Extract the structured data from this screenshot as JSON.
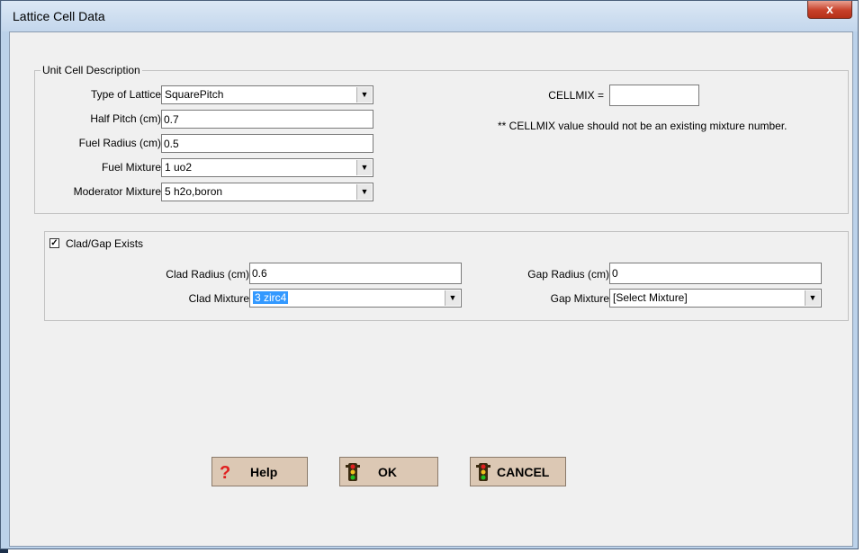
{
  "window": {
    "title": "Lattice Cell Data",
    "close_label": "x"
  },
  "unit_cell": {
    "legend": "Unit Cell Description",
    "type_of_lattice": {
      "label": "Type of Lattice",
      "value": "SquarePitch"
    },
    "half_pitch": {
      "label": "Half Pitch (cm)",
      "value": "0.7"
    },
    "fuel_radius": {
      "label": "Fuel Radius (cm)",
      "value": "0.5"
    },
    "fuel_mixture": {
      "label": "Fuel Mixture",
      "value": "1 uo2"
    },
    "moderator_mixture": {
      "label": "Moderator Mixture",
      "value": "5 h2o,boron"
    },
    "cellmix": {
      "label": "CELLMIX =",
      "value": ""
    },
    "cellmix_note": "** CELLMIX value should not be an existing mixture number."
  },
  "clad_gap": {
    "checkbox_label": "Clad/Gap Exists",
    "checked": true,
    "clad_radius": {
      "label": "Clad Radius (cm)",
      "value": "0.6"
    },
    "clad_mixture": {
      "label": "Clad Mixture",
      "value": "3 zirc4"
    },
    "gap_radius": {
      "label": "Gap Radius (cm)",
      "value": "0"
    },
    "gap_mixture": {
      "label": "Gap Mixture",
      "value": "[Select Mixture]"
    }
  },
  "buttons": {
    "help": "Help",
    "ok": "OK",
    "cancel": "CANCEL"
  },
  "icons": {
    "help": "question-mark-icon",
    "ok": "traffic-light-icon",
    "cancel": "traffic-light-icon"
  },
  "colors": {
    "selection": "#3399ff",
    "button_face": "#dcc8b4",
    "help_icon": "#e02020"
  }
}
